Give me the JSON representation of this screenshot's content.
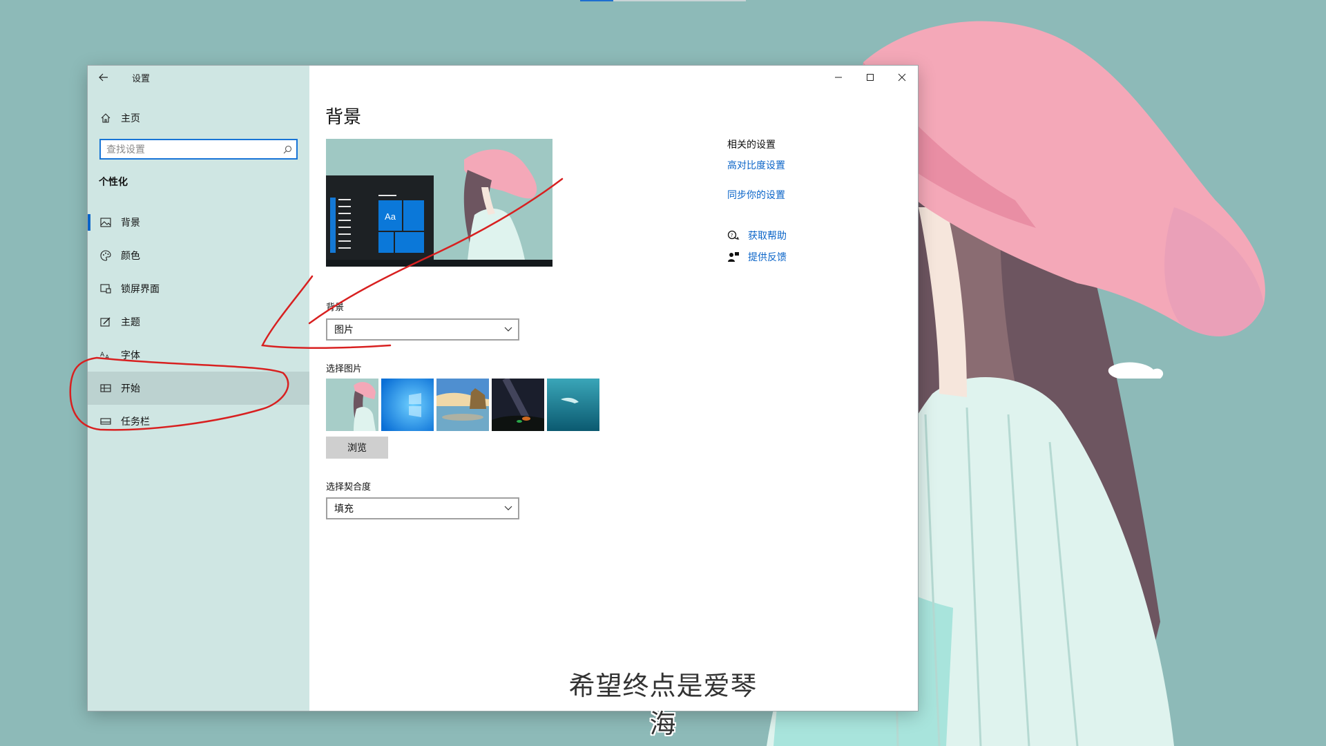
{
  "window": {
    "app_title": "设置",
    "minimize_icon": "minimize-icon",
    "maximize_icon": "maximize-icon",
    "close_icon": "close-icon"
  },
  "sidebar": {
    "home_label": "主页",
    "search_placeholder": "查找设置",
    "section_heading": "个性化",
    "items": [
      {
        "label": "背景",
        "icon": "picture-icon",
        "selected": true
      },
      {
        "label": "颜色",
        "icon": "palette-icon"
      },
      {
        "label": "锁屏界面",
        "icon": "lock-screen-icon"
      },
      {
        "label": "主题",
        "icon": "theme-brush-icon"
      },
      {
        "label": "字体",
        "icon": "font-icon"
      },
      {
        "label": "开始",
        "icon": "start-icon",
        "hover": true
      },
      {
        "label": "任务栏",
        "icon": "taskbar-icon"
      }
    ]
  },
  "content": {
    "page_title": "背景",
    "preview_tile_text": "Aa",
    "background_label": "背景",
    "background_value": "图片",
    "choose_picture_label": "选择图片",
    "browse_label": "浏览",
    "fit_label": "选择契合度",
    "fit_value": "填充"
  },
  "related": {
    "heading": "相关的设置",
    "links": [
      "高对比度设置",
      "同步你的设置"
    ],
    "help_label": "获取帮助",
    "feedback_label": "提供反馈"
  },
  "subtitle": "希望终点是爱琴海",
  "colors": {
    "desktop": "#8dbab8",
    "sidebar": "#cfe6e3",
    "accent": "#0a64c8",
    "annotation": "#d82020"
  }
}
